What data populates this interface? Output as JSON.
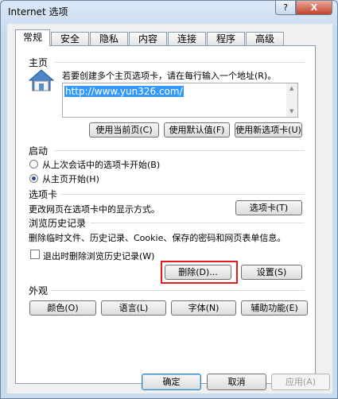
{
  "window": {
    "title": "Internet 选项",
    "help": "?",
    "close": "X"
  },
  "tabs": [
    "常规",
    "安全",
    "隐私",
    "内容",
    "连接",
    "程序",
    "高级"
  ],
  "home": {
    "heading": "主页",
    "instruction": "若要创建多个主页选项卡，请在每行输入一个地址(R)。",
    "url": "http://www.yun326.com/",
    "use_current": "使用当前页(C)",
    "use_default": "使用默认值(F)",
    "use_new_tab": "使用新选项卡(U)"
  },
  "startup": {
    "heading": "启动",
    "option_last_session": "从上次会话中的选项卡开始(B)",
    "option_home": "从主页开始(H)",
    "selected": "option_home"
  },
  "tabs_section": {
    "heading": "选项卡",
    "desc": "更改网页在选项卡中的显示方式。",
    "button": "选项卡(T)"
  },
  "history": {
    "heading": "浏览历史记录",
    "desc": "删除临时文件、历史记录、Cookie、保存的密码和网页表单信息。",
    "checkbox": "退出时删除浏览历史记录(W)",
    "checked": false,
    "delete": "删除(D)...",
    "settings": "设置(S)"
  },
  "appearance": {
    "heading": "外观",
    "colors": "颜色(O)",
    "languages": "语言(L)",
    "fonts": "字体(N)",
    "accessibility": "辅助功能(E)"
  },
  "footer": {
    "ok": "确定",
    "cancel": "取消",
    "apply": "应用(A)"
  },
  "colors": {
    "highlight": "#e8191d",
    "selection": "#3399ff"
  }
}
